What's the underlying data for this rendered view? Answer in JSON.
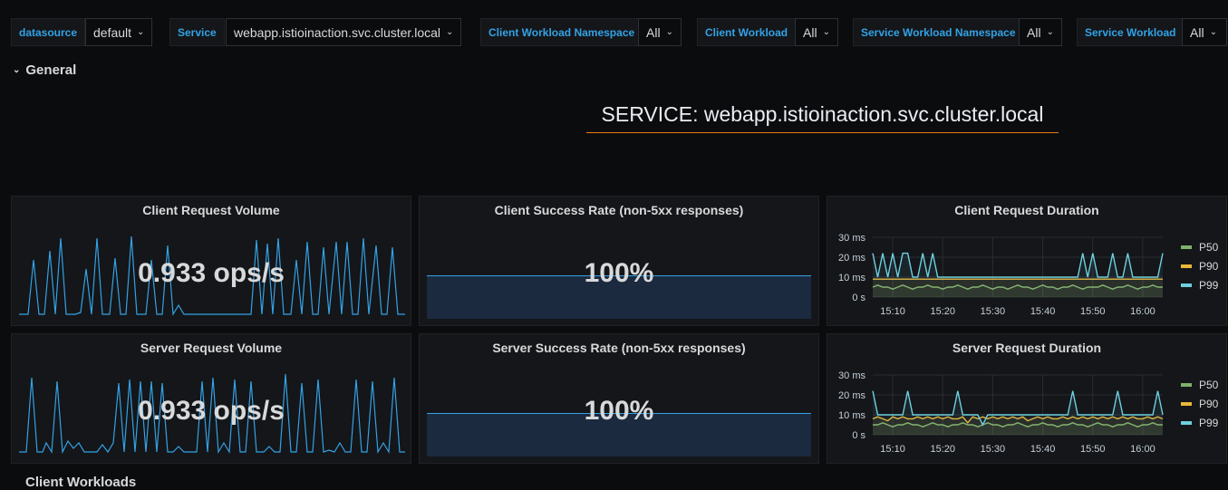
{
  "variables": [
    {
      "label": "datasource",
      "value": "default"
    },
    {
      "label": "Service",
      "value": "webapp.istioinaction.svc.cluster.local"
    },
    {
      "label": "Client Workload Namespace",
      "value": "All"
    },
    {
      "label": "Client Workload",
      "value": "All"
    },
    {
      "label": "Service Workload Namespace",
      "value": "All"
    },
    {
      "label": "Service Workload",
      "value": "All"
    }
  ],
  "row": {
    "title": "General"
  },
  "banner": {
    "text": "SERVICE: webapp.istioinaction.svc.cluster.local"
  },
  "panels": {
    "client_volume": {
      "title": "Client Request Volume",
      "value": "0.933 ops/s"
    },
    "client_success": {
      "title": "Client Success Rate (non-5xx responses)",
      "value": "100%"
    },
    "client_duration": {
      "title": "Client Request Duration"
    },
    "server_volume": {
      "title": "Server Request Volume",
      "value": "0.933 ops/s"
    },
    "server_success": {
      "title": "Server Success Rate (non-5xx responses)",
      "value": "100%"
    },
    "server_duration": {
      "title": "Server Request Duration"
    }
  },
  "legend": [
    {
      "name": "P50",
      "color": "#7eb26d"
    },
    {
      "name": "P90",
      "color": "#eab839"
    },
    {
      "name": "P99",
      "color": "#6ed0e0"
    }
  ],
  "next_row": {
    "title": "Client Workloads"
  },
  "chart_data": [
    {
      "type": "line",
      "title": "Client Request Duration",
      "x": [
        "15:06",
        "15:07",
        "15:08",
        "15:09",
        "15:10",
        "15:11",
        "15:12",
        "15:13",
        "15:14",
        "15:15",
        "15:16",
        "15:17",
        "15:18",
        "15:19",
        "15:20",
        "15:21",
        "15:22",
        "15:23",
        "15:24",
        "15:25",
        "15:26",
        "15:27",
        "15:28",
        "15:29",
        "15:30",
        "15:31",
        "15:32",
        "15:33",
        "15:34",
        "15:35",
        "15:36",
        "15:37",
        "15:38",
        "15:39",
        "15:40",
        "15:41",
        "15:42",
        "15:43",
        "15:44",
        "15:45",
        "15:46",
        "15:47",
        "15:48",
        "15:49",
        "15:50",
        "15:51",
        "15:52",
        "15:53",
        "15:54",
        "15:55",
        "15:56",
        "15:57",
        "15:58",
        "15:59",
        "16:00",
        "16:01",
        "16:02",
        "16:03",
        "16:04"
      ],
      "x_ticks": [
        "15:10",
        "15:20",
        "15:30",
        "15:40",
        "15:50",
        "16:00"
      ],
      "ylim": [
        0,
        30
      ],
      "y_ticks": [
        "30 ms",
        "20 ms",
        "10 ms",
        "0 s"
      ],
      "series": [
        {
          "name": "P50",
          "values": [
            5,
            6,
            5,
            5,
            4,
            5,
            6,
            5,
            4,
            5,
            5,
            6,
            5,
            5,
            4,
            5,
            5,
            6,
            5,
            4,
            5,
            5,
            6,
            5,
            4,
            5,
            5,
            4,
            5,
            6,
            5,
            5,
            4,
            5,
            6,
            5,
            5,
            4,
            5,
            5,
            6,
            5,
            4,
            5,
            5,
            5,
            6,
            5,
            4,
            5,
            5,
            6,
            5,
            4,
            5,
            5,
            6,
            5,
            5
          ]
        },
        {
          "name": "P90",
          "values": [
            9,
            9,
            9,
            9,
            9,
            9,
            9,
            9,
            9,
            9,
            9,
            9,
            9,
            9,
            9,
            9,
            9,
            9,
            9,
            9,
            9,
            9,
            9,
            9,
            9,
            9,
            9,
            9,
            9,
            9,
            9,
            9,
            9,
            9,
            9,
            9,
            9,
            9,
            9,
            9,
            9,
            9,
            9,
            9,
            9,
            9,
            9,
            9,
            9,
            9,
            9,
            9,
            9,
            9,
            9,
            9,
            9,
            9,
            9
          ]
        },
        {
          "name": "P99",
          "values": [
            22,
            10,
            22,
            10,
            22,
            10,
            22,
            22,
            10,
            10,
            22,
            10,
            22,
            10,
            10,
            10,
            10,
            10,
            10,
            10,
            10,
            10,
            10,
            10,
            10,
            10,
            10,
            10,
            10,
            10,
            10,
            10,
            10,
            10,
            10,
            10,
            10,
            10,
            10,
            10,
            10,
            10,
            22,
            10,
            22,
            10,
            10,
            10,
            22,
            10,
            10,
            22,
            10,
            10,
            10,
            10,
            10,
            10,
            22
          ]
        }
      ]
    },
    {
      "type": "line",
      "title": "Server Request Duration",
      "x": [
        "15:06",
        "15:07",
        "15:08",
        "15:09",
        "15:10",
        "15:11",
        "15:12",
        "15:13",
        "15:14",
        "15:15",
        "15:16",
        "15:17",
        "15:18",
        "15:19",
        "15:20",
        "15:21",
        "15:22",
        "15:23",
        "15:24",
        "15:25",
        "15:26",
        "15:27",
        "15:28",
        "15:29",
        "15:30",
        "15:31",
        "15:32",
        "15:33",
        "15:34",
        "15:35",
        "15:36",
        "15:37",
        "15:38",
        "15:39",
        "15:40",
        "15:41",
        "15:42",
        "15:43",
        "15:44",
        "15:45",
        "15:46",
        "15:47",
        "15:48",
        "15:49",
        "15:50",
        "15:51",
        "15:52",
        "15:53",
        "15:54",
        "15:55",
        "15:56",
        "15:57",
        "15:58",
        "15:59",
        "16:00",
        "16:01",
        "16:02",
        "16:03",
        "16:04"
      ],
      "x_ticks": [
        "15:10",
        "15:20",
        "15:30",
        "15:40",
        "15:50",
        "16:00"
      ],
      "ylim": [
        0,
        30
      ],
      "y_ticks": [
        "30 ms",
        "20 ms",
        "10 ms",
        "0 s"
      ],
      "series": [
        {
          "name": "P50",
          "values": [
            5,
            5,
            6,
            5,
            4,
            5,
            5,
            6,
            5,
            5,
            4,
            5,
            6,
            5,
            5,
            4,
            5,
            5,
            6,
            5,
            5,
            4,
            5,
            6,
            5,
            5,
            4,
            5,
            5,
            6,
            5,
            4,
            5,
            5,
            6,
            5,
            5,
            4,
            5,
            5,
            6,
            5,
            5,
            4,
            5,
            6,
            5,
            5,
            4,
            5,
            5,
            6,
            5,
            4,
            5,
            5,
            6,
            5,
            5
          ]
        },
        {
          "name": "P90",
          "values": [
            8,
            9,
            8,
            7,
            9,
            8,
            9,
            8,
            8,
            9,
            8,
            9,
            8,
            9,
            8,
            9,
            8,
            8,
            9,
            6,
            9,
            8,
            9,
            8,
            9,
            8,
            9,
            8,
            9,
            8,
            9,
            7,
            8,
            9,
            8,
            9,
            8,
            8,
            9,
            8,
            9,
            8,
            9,
            8,
            9,
            8,
            9,
            8,
            9,
            8,
            9,
            8,
            9,
            8,
            8,
            9,
            8,
            9,
            8
          ]
        },
        {
          "name": "P99",
          "values": [
            22,
            10,
            10,
            10,
            10,
            10,
            10,
            22,
            10,
            10,
            10,
            10,
            10,
            10,
            10,
            10,
            10,
            22,
            10,
            10,
            10,
            10,
            5,
            10,
            10,
            10,
            10,
            10,
            10,
            10,
            10,
            10,
            10,
            10,
            10,
            10,
            10,
            10,
            10,
            10,
            22,
            10,
            10,
            10,
            10,
            10,
            10,
            10,
            10,
            22,
            10,
            10,
            10,
            10,
            10,
            10,
            10,
            22,
            10
          ]
        }
      ]
    }
  ]
}
